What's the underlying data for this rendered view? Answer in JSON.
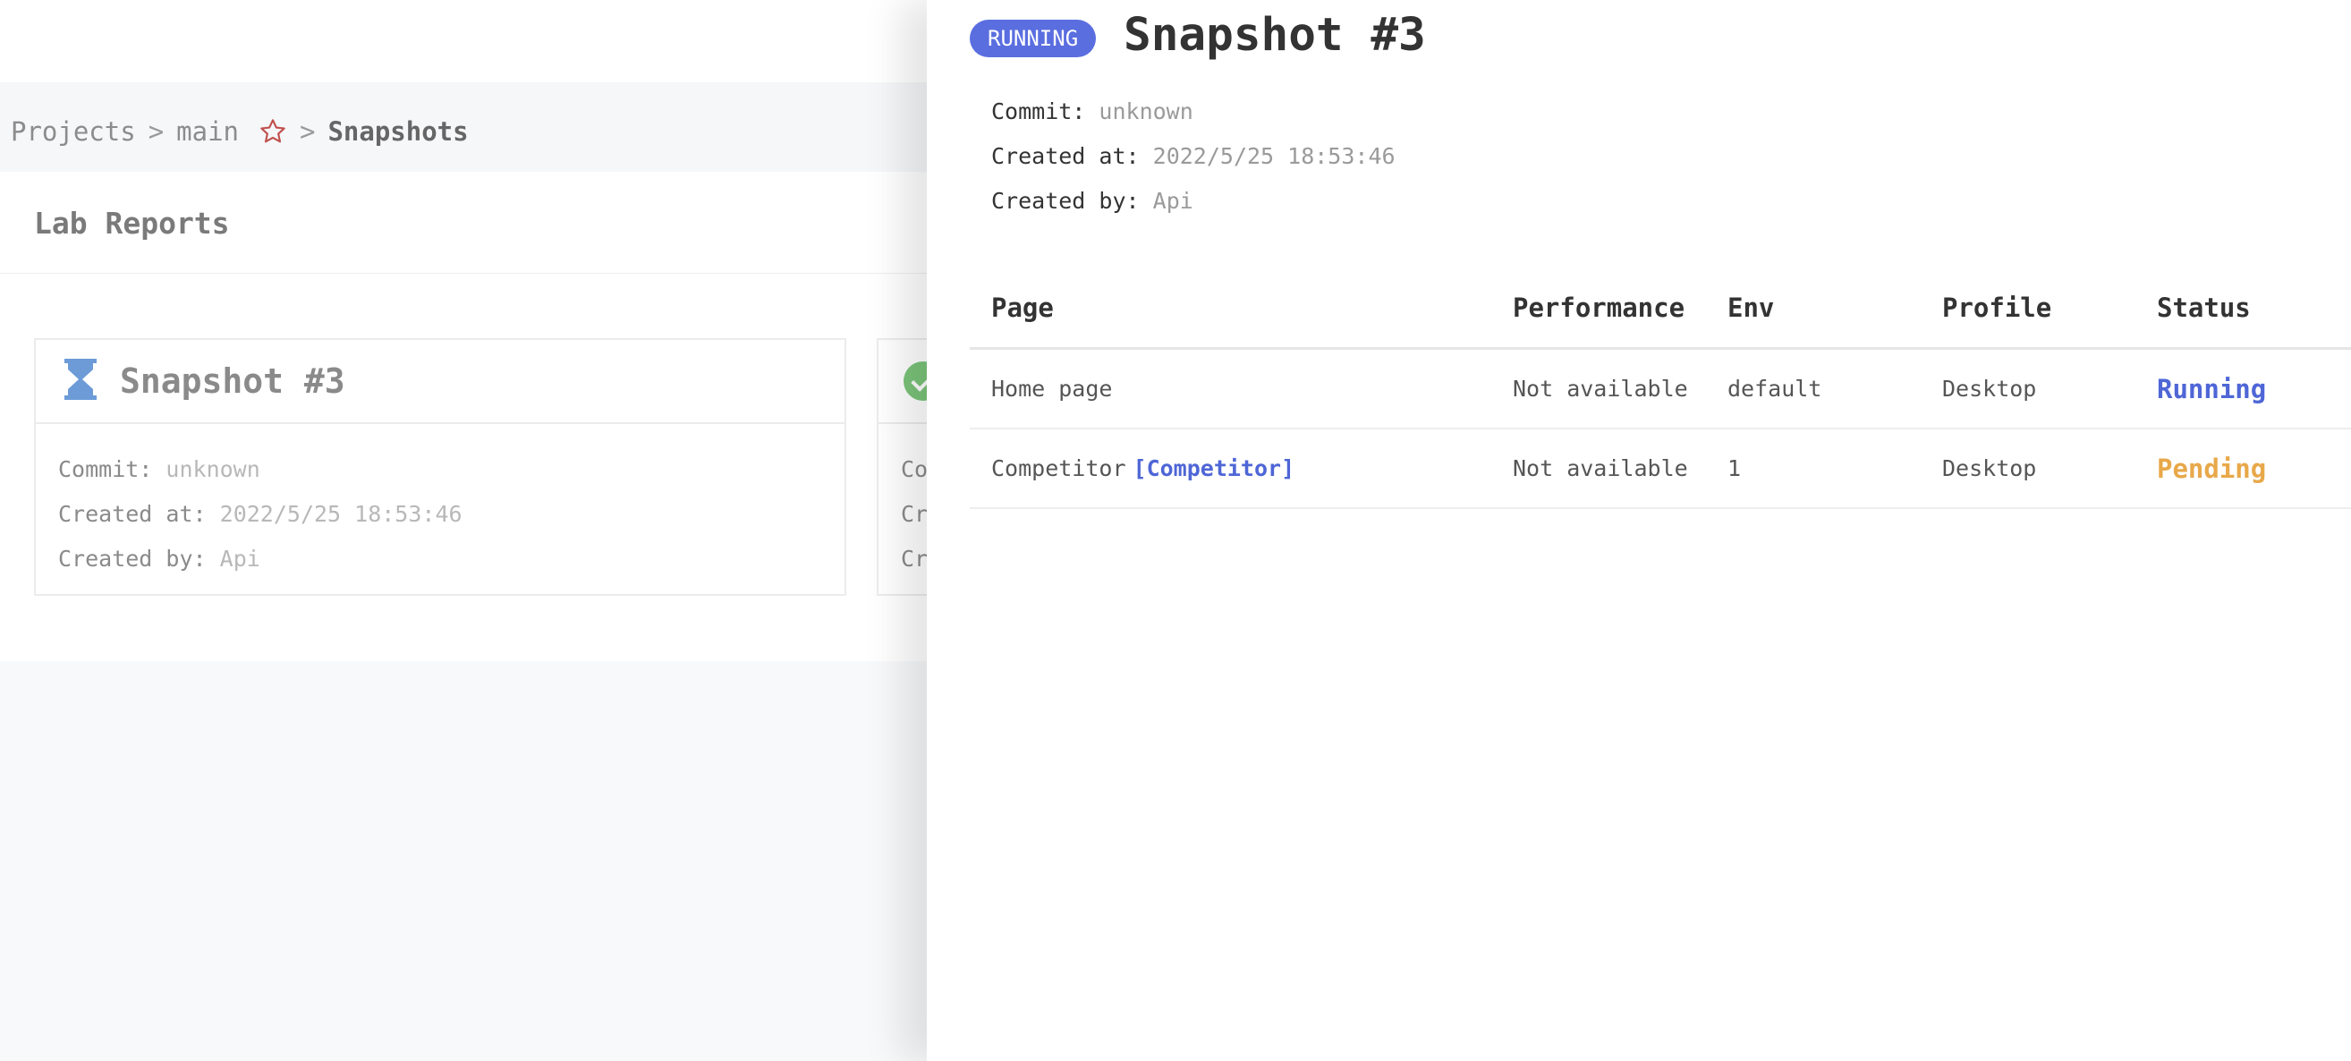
{
  "colors": {
    "accent": "#5a6ee0",
    "running": "#4e66d6",
    "pending": "#e8a84a",
    "success": "#7bc47a",
    "favorite_star": "#c0504d"
  },
  "breadcrumb": {
    "items": [
      "Projects",
      "main",
      "Snapshots"
    ],
    "separator": ">",
    "favorite_icon": "star-outline-icon"
  },
  "page": {
    "section_title": "Lab Reports"
  },
  "cards": [
    {
      "icon": "hourglass-icon",
      "title": "Snapshot #3",
      "commit_label": "Commit:",
      "commit_value": "unknown",
      "created_at_label": "Created at:",
      "created_at_value": "2022/5/25 18:53:46",
      "created_by_label": "Created by:",
      "created_by_value": "Api"
    },
    {
      "icon": "check-circle-icon",
      "line1": "Co",
      "line2": "Cr",
      "line3": "Cr"
    }
  ],
  "drawer": {
    "status_badge": "RUNNING",
    "title": "Snapshot #3",
    "commit_label": "Commit:",
    "commit_value": "unknown",
    "created_at_label": "Created at:",
    "created_at_value": "2022/5/25 18:53:46",
    "created_by_label": "Created by:",
    "created_by_value": "Api",
    "table": {
      "headers": [
        "Page",
        "Performance",
        "Env",
        "Profile",
        "Status"
      ],
      "rows": [
        {
          "page": "Home page",
          "tag": "",
          "performance": "Not available",
          "env": "default",
          "profile": "Desktop",
          "status": "Running"
        },
        {
          "page": "Competitor",
          "tag": "[Competitor]",
          "performance": "Not available",
          "env": "1",
          "profile": "Desktop",
          "status": "Pending"
        }
      ]
    }
  }
}
